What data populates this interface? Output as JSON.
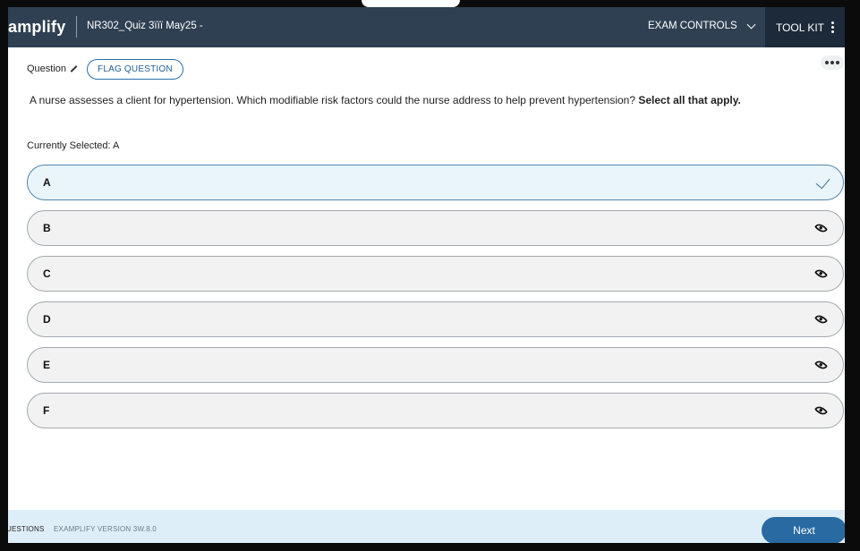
{
  "header": {
    "logo": "amplify",
    "exam_title": "NR302_Quiz 3ïïï May25 -",
    "exam_controls_label": "EXAM CONTROLS",
    "toolkit_label": "TOOL KIT"
  },
  "question": {
    "label": "Question",
    "flag_label": "FLAG QUESTION",
    "stem": "A nurse assesses a client for hypertension. Which modifiable risk factors could the nurse address to help prevent hypertension?",
    "stem_emphasis": "Select all that apply.",
    "currently_selected": "Currently Selected: A"
  },
  "options": [
    {
      "letter": "A",
      "selected": true,
      "icon": "check-icon"
    },
    {
      "letter": "B",
      "selected": false,
      "icon": "eye-icon"
    },
    {
      "letter": "C",
      "selected": false,
      "icon": "eye-icon"
    },
    {
      "letter": "D",
      "selected": false,
      "icon": "eye-icon"
    },
    {
      "letter": "E",
      "selected": false,
      "icon": "eye-icon"
    },
    {
      "letter": "F",
      "selected": false,
      "icon": "eye-icon"
    }
  ],
  "footer": {
    "questions_label": "UESTIONS",
    "version": "EXAMPLIFY VERSION 3W.8.0",
    "next_label": "Next"
  },
  "colors": {
    "header_bg": "#2e4052",
    "toolkit_bg": "#1c2a3a",
    "accent": "#2a6aa2",
    "selected_bg": "#eaf5fb",
    "footer_bg": "#deeef8"
  }
}
